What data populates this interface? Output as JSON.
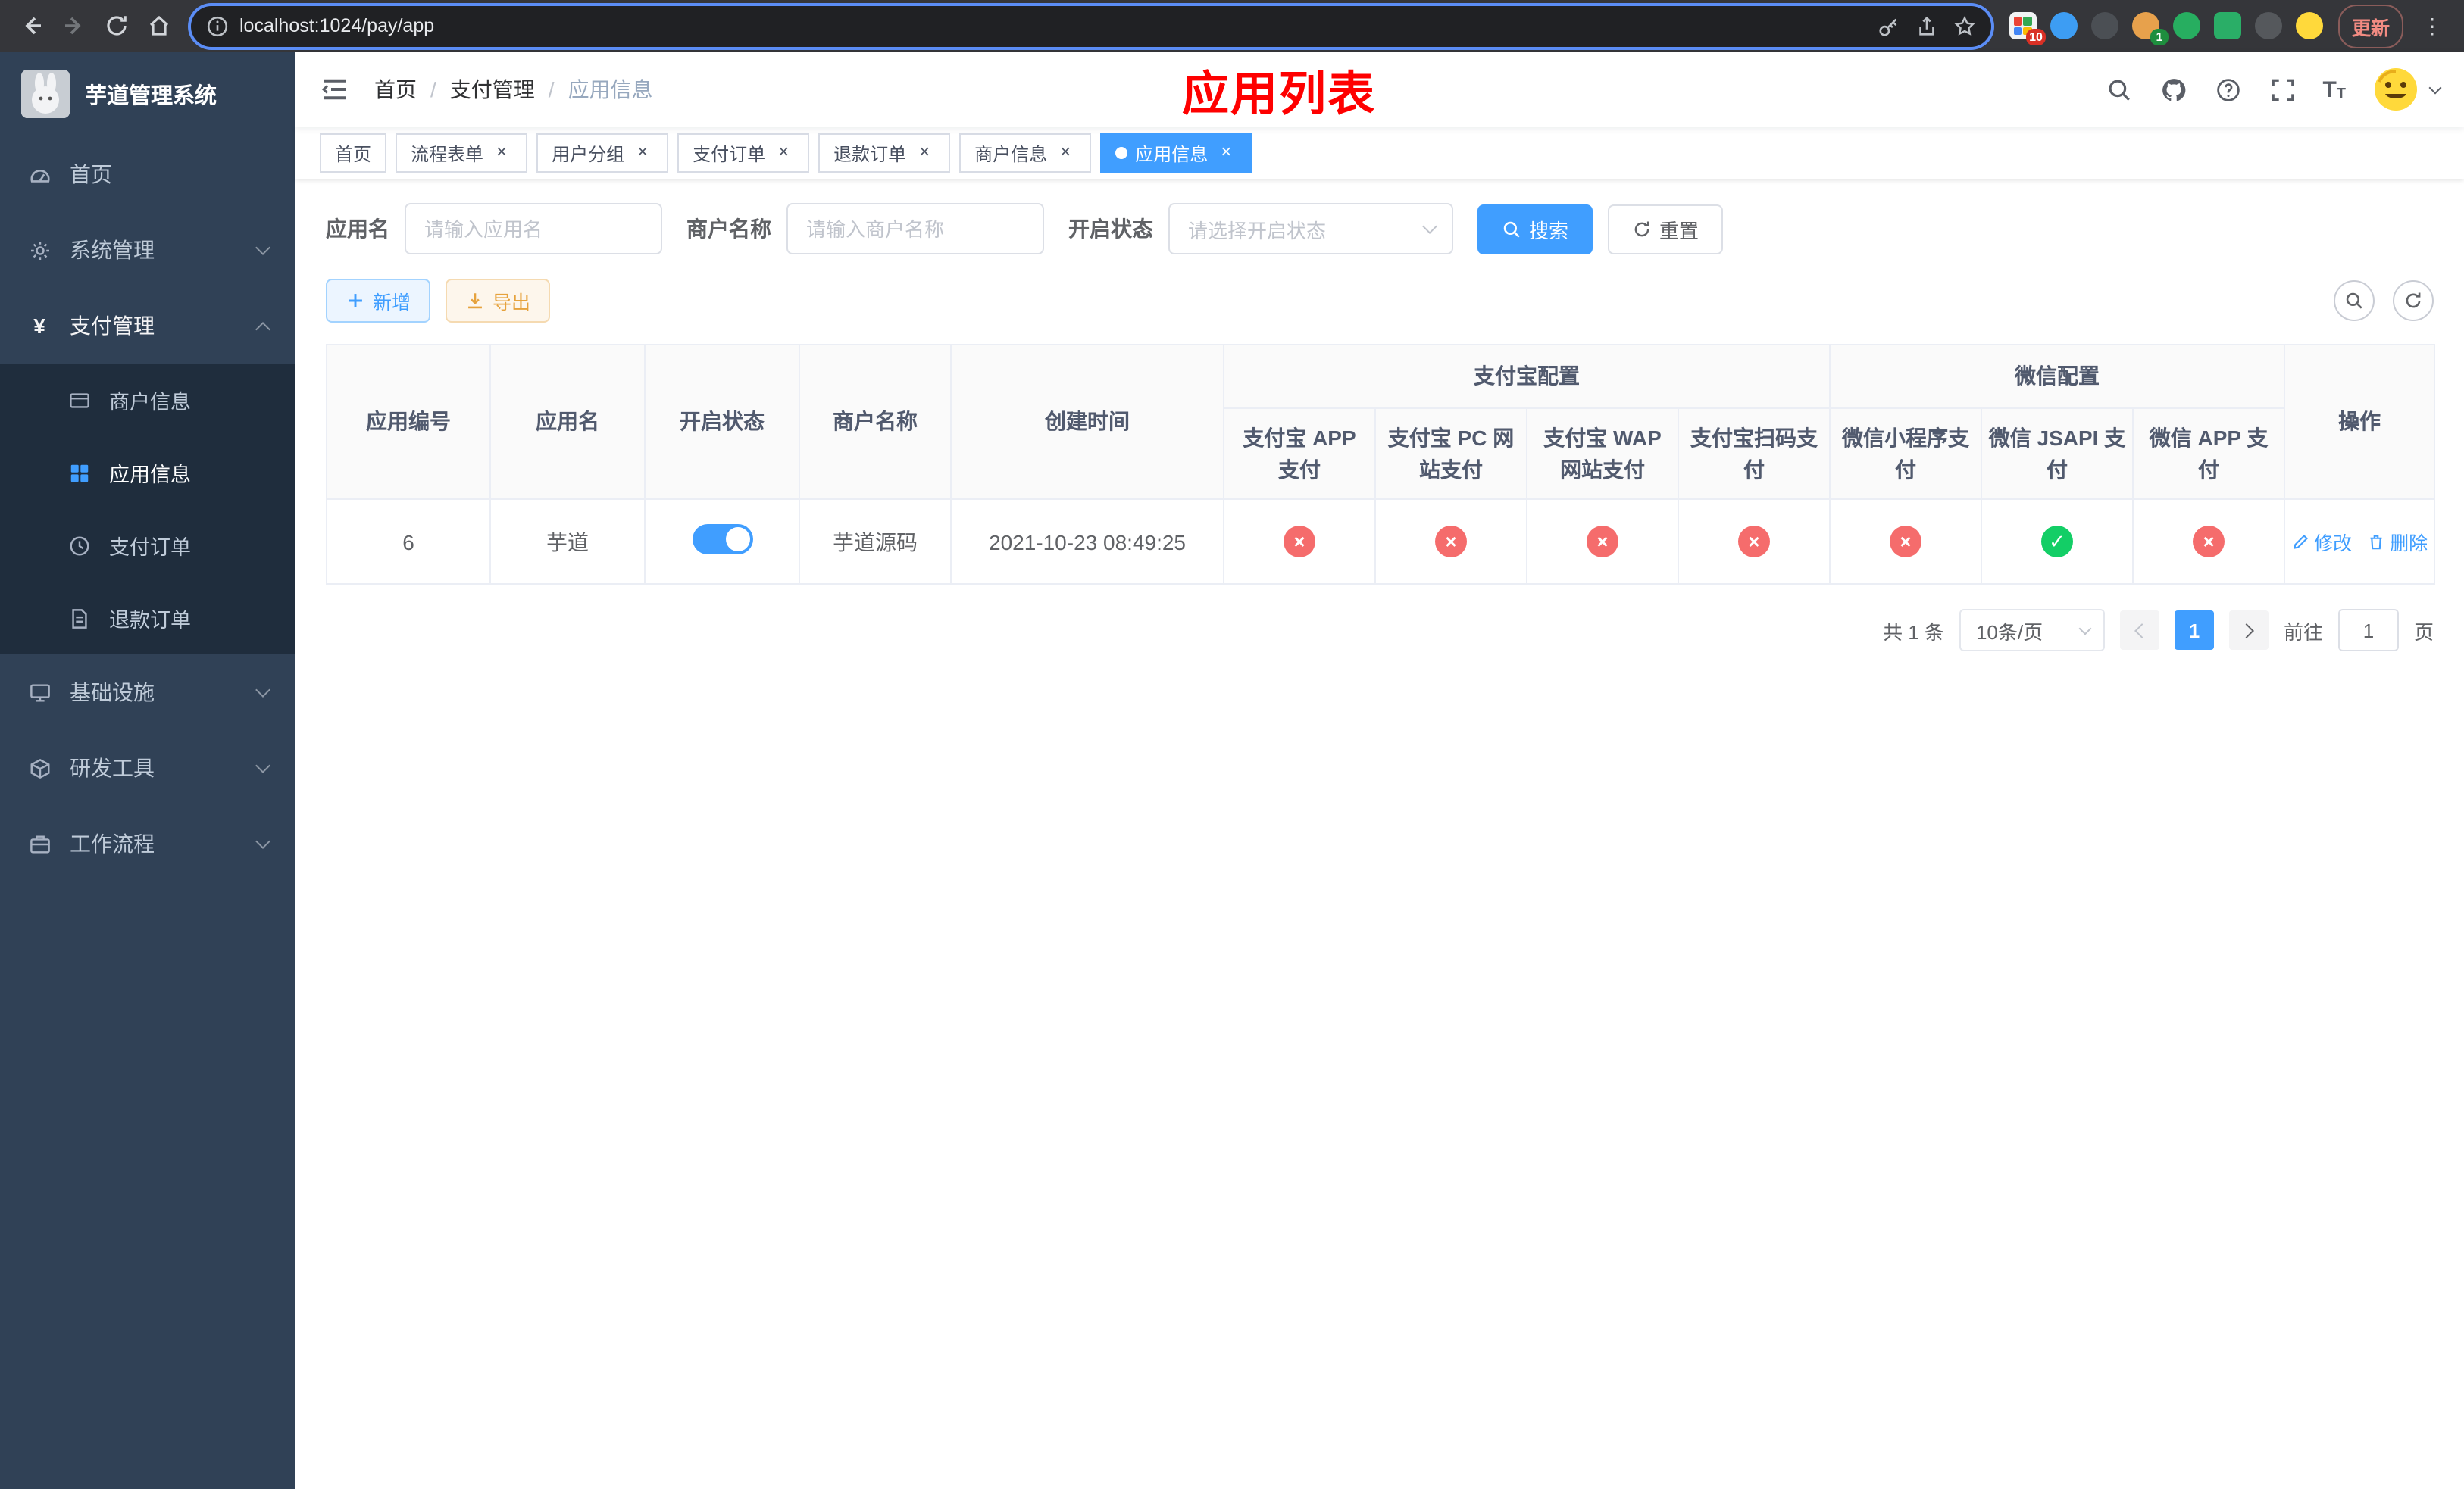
{
  "browser": {
    "url": "localhost:1024/pay/app",
    "update_label": "更新",
    "extensions": {
      "badge_a": "10",
      "badge_b": "1"
    }
  },
  "sidebar": {
    "title": "芋道管理系统",
    "items": {
      "home": "首页",
      "system": "系统管理",
      "payment": "支付管理",
      "infra": "基础设施",
      "devtools": "研发工具",
      "workflow": "工作流程"
    },
    "payment_children": {
      "merchant": "商户信息",
      "app": "应用信息",
      "pay_order": "支付订单",
      "refund_order": "退款订单"
    }
  },
  "navbar": {
    "breadcrumb": [
      "首页",
      "支付管理",
      "应用信息"
    ],
    "annotation": "应用列表"
  },
  "tabs": [
    {
      "label": "首页"
    },
    {
      "label": "流程表单"
    },
    {
      "label": "用户分组"
    },
    {
      "label": "支付订单"
    },
    {
      "label": "退款订单"
    },
    {
      "label": "商户信息"
    },
    {
      "label": "应用信息"
    }
  ],
  "filters": {
    "app_name_label": "应用名",
    "app_name_placeholder": "请输入应用名",
    "merchant_label": "商户名称",
    "merchant_placeholder": "请输入商户名称",
    "status_label": "开启状态",
    "status_placeholder": "请选择开启状态",
    "search_label": "搜索",
    "reset_label": "重置"
  },
  "toolbar": {
    "add_label": "新增",
    "export_label": "导出"
  },
  "table": {
    "group_headers": {
      "alipay": "支付宝配置",
      "wechat": "微信配置"
    },
    "columns": [
      "应用编号",
      "应用名",
      "开启状态",
      "商户名称",
      "创建时间",
      "支付宝 APP 支付",
      "支付宝 PC 网站支付",
      "支付宝 WAP 网站支付",
      "支付宝扫码支付",
      "微信小程序支付",
      "微信 JSAPI 支付",
      "微信 APP 支付",
      "操作"
    ],
    "rows": [
      {
        "id": "6",
        "name": "芋道",
        "status_on": true,
        "merchant": "芋道源码",
        "created": "2021-10-23 08:49:25",
        "alipay_app": false,
        "alipay_pc": false,
        "alipay_wap": false,
        "alipay_qr": false,
        "wx_mini": false,
        "wx_jsapi": true,
        "wx_app": false,
        "edit_label": "修改",
        "delete_label": "删除"
      }
    ]
  },
  "pagination": {
    "total": "共 1 条",
    "page_size": "10条/页",
    "current_page": "1",
    "goto_label": "前往",
    "goto_value": "1",
    "page_unit": "页"
  },
  "colors": {
    "primary": "#409eff",
    "success": "#13ce66",
    "danger": "#f56c6c",
    "warning": "#e6a23c",
    "annotation_red": "#fe0000",
    "sidebar_bg": "#304156",
    "submenu_bg": "#1f2d3d"
  }
}
